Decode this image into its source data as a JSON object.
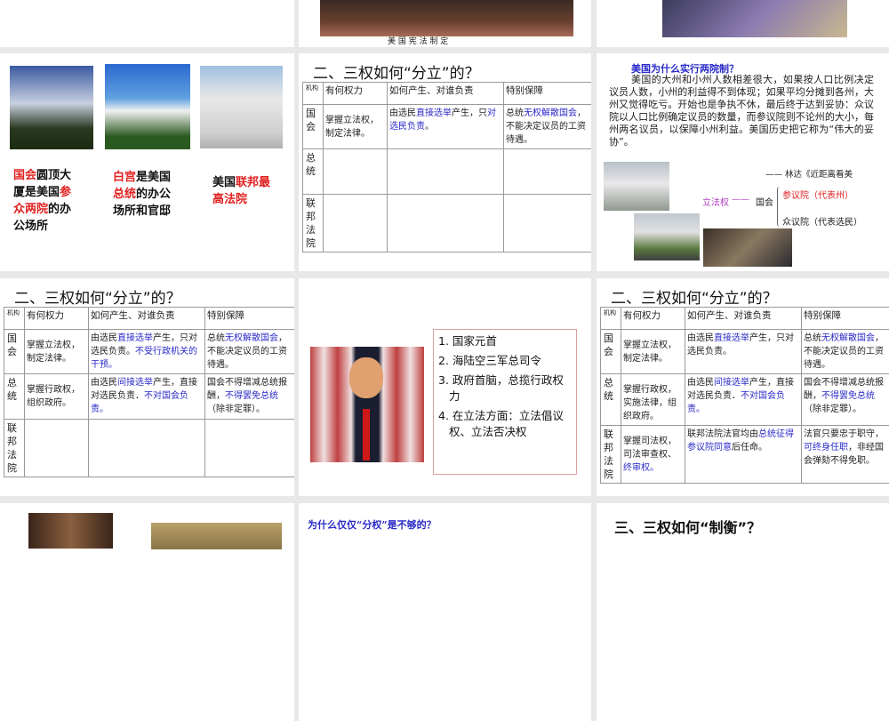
{
  "slides_top": {
    "caption": "美 国 宪 法 制 定"
  },
  "buildings": {
    "captions": [
      [
        [
          "国会",
          "r"
        ],
        [
          "圆顶大厦是美国",
          ""
        ],
        [
          "参众两院",
          "r"
        ],
        [
          "的办公场所",
          ""
        ]
      ],
      [
        [
          "白宫",
          "r"
        ],
        [
          "是美国",
          ""
        ],
        [
          "总统",
          "r"
        ],
        [
          "的办公场所和官邸",
          ""
        ]
      ],
      [
        [
          "美国",
          ""
        ],
        [
          "联邦最高法院",
          "r"
        ]
      ]
    ]
  },
  "table_header": [
    "机构",
    "有何权力",
    "如何产生、对谁负责",
    "特别保障"
  ],
  "table_title": "二、三权如何“分立”的？",
  "orgs": [
    "国会",
    "总统",
    "联邦法院"
  ],
  "tables": [
    {
      "rows": [
        [
          [
            [
              "掌握立法权，制定法律。",
              ""
            ]
          ],
          [
            [
              "由选民",
              ""
            ],
            [
              "直接选举",
              "b"
            ],
            [
              "产生，只",
              ""
            ],
            [
              "对选民负责",
              "b"
            ],
            [
              "。",
              ""
            ]
          ],
          [
            [
              "总统",
              ""
            ],
            [
              "无权解散国会",
              "b"
            ],
            [
              "，不能决定议员的工资待遇。",
              ""
            ]
          ]
        ],
        [
          [],
          [],
          []
        ],
        [
          [],
          [],
          []
        ]
      ]
    },
    {
      "rows": [
        [
          [
            [
              "掌握立法权，制定法律。",
              ""
            ]
          ],
          [
            [
              "由选民",
              ""
            ],
            [
              "直接选举",
              "b"
            ],
            [
              "产生，只对选民负责。",
              ""
            ],
            [
              "不受行政机关的干预。",
              "b"
            ]
          ],
          [
            [
              "总统",
              ""
            ],
            [
              "无权解散国会",
              "b"
            ],
            [
              "，不能决定议员的工资待遇。",
              ""
            ]
          ]
        ],
        [
          [
            [
              "掌握行政权，组织政府。",
              ""
            ]
          ],
          [
            [
              "由选民",
              ""
            ],
            [
              "间接选举",
              "b"
            ],
            [
              "产生，直接对选民负责．",
              ""
            ],
            [
              "不对国会负责。",
              "b"
            ]
          ],
          [
            [
              "国会不得增减总统报酬，",
              ""
            ],
            [
              "不得罢免总统",
              "b"
            ],
            [
              "（除非定罪）。",
              ""
            ]
          ]
        ],
        [
          [],
          [],
          []
        ]
      ]
    },
    {
      "rows": [
        [
          [
            [
              "掌握立法权，制定法律。",
              ""
            ]
          ],
          [
            [
              "由选民",
              ""
            ],
            [
              "直接选举",
              "b"
            ],
            [
              "产生，只对选民负责。",
              ""
            ]
          ],
          [
            [
              "总统",
              ""
            ],
            [
              "无权解散国会",
              "b"
            ],
            [
              "，不能决定议员的工资待遇。",
              ""
            ]
          ]
        ],
        [
          [
            [
              "掌握行政权，实施法律，组织政府。",
              ""
            ]
          ],
          [
            [
              "由选民",
              ""
            ],
            [
              "间接选举",
              "b"
            ],
            [
              "产生，直接对选民负责．",
              ""
            ],
            [
              "不对国会负责。",
              "b"
            ]
          ],
          [
            [
              "国会不得增减总统报酬，",
              ""
            ],
            [
              "不得罢免总统",
              "b"
            ],
            [
              "（除非定罪）。",
              ""
            ]
          ]
        ],
        [
          [
            [
              "掌握司法权，司法审查权、",
              ""
            ],
            [
              "终审权。",
              "b"
            ]
          ],
          [
            [
              "联邦法院法官均由",
              ""
            ],
            [
              "总统征得参议院同意",
              "b"
            ],
            [
              "后任命。",
              ""
            ]
          ],
          [
            [
              "法官只要忠于职守，",
              ""
            ],
            [
              "可终身任职",
              "b"
            ],
            [
              "，非经国会弹劾不得免职。",
              ""
            ]
          ]
        ]
      ]
    }
  ],
  "bicameral": {
    "title": "美国为什么实行两院制？",
    "body": "美国的大州和小州人数相差很大，如果按人口比例决定议员人数，小州的利益得不到体现；如果平均分摊到各州，大州又觉得吃亏。开始也是争执不休，最后终于达到妥协：众议院以人口比例确定议员的数量，而参议院则不论州的大小，每州两名议员，以保障小州利益。美国历史把它称为“伟大的妥协”。",
    "source": "—— 林达《近距离看美",
    "legislative": "立法权",
    "dash": "——",
    "congress": "国会",
    "senate": "参议院（代表州）",
    "house": "众议院（代表选民）"
  },
  "president": {
    "items": [
      "1. 国家元首",
      "2. 海陆空三军总司令",
      "3. 政府首脑，总揽行政权力",
      "4. 在立法方面：立法倡议权、立法否决权"
    ]
  },
  "bottom": {
    "question": "为什么仅仅“分权”是不够的？",
    "title3": "三、三权如何“制衡”？"
  },
  "colors": {
    "blue": "#2a2ac8",
    "red": "#e02020",
    "purple": "#b040c0"
  }
}
